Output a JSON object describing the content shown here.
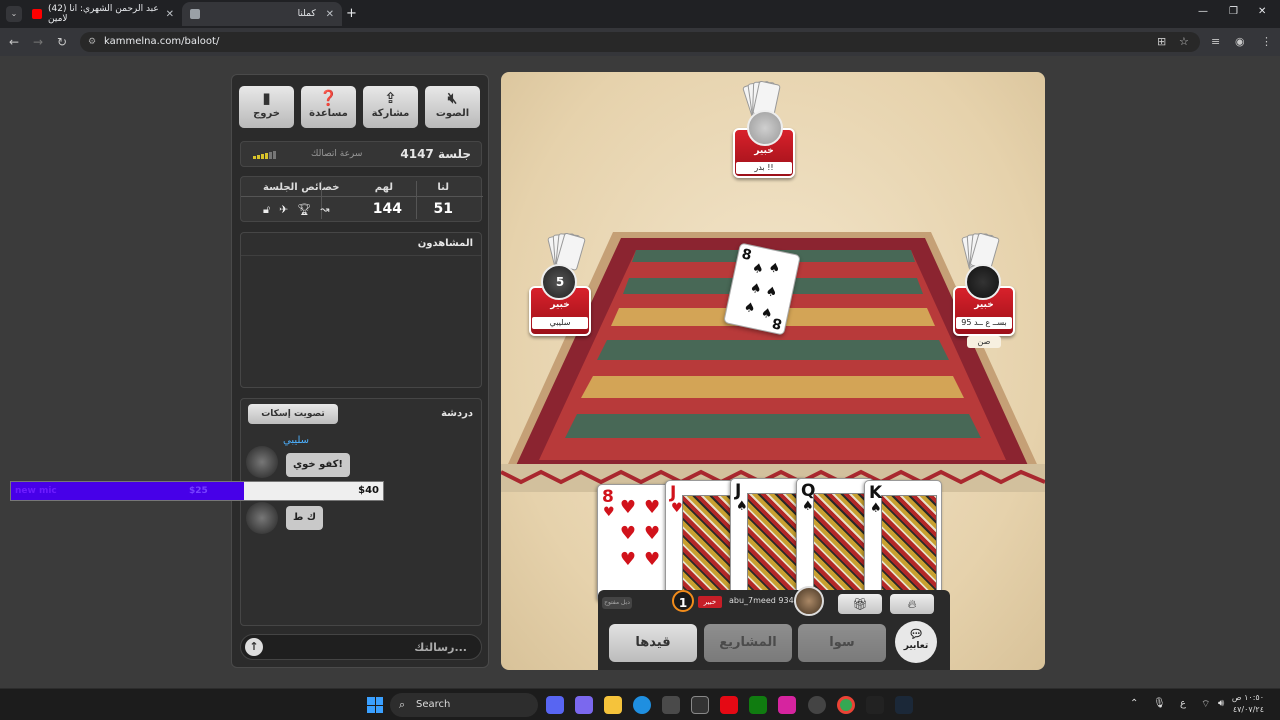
{
  "browser": {
    "tabs": [
      {
        "title": "(42) عبد الرحمن الشهري: انا لامين",
        "active": false,
        "favicon_color": "#ff0000"
      },
      {
        "title": "كملنا",
        "active": true,
        "favicon_color": "#9aa0a6"
      }
    ],
    "new_tab": "+",
    "url": "kammelna.com/baloot/"
  },
  "sidebar": {
    "buttons": [
      {
        "label": "خروج",
        "icon": "door-icon"
      },
      {
        "label": "مساعدة",
        "icon": "help-icon"
      },
      {
        "label": "مشاركة",
        "icon": "share-icon"
      },
      {
        "label": "الصوت",
        "icon": "mute-icon"
      }
    ],
    "session_label": "جلسة 4147",
    "connection_label": "سرعة اتصالك",
    "scores": {
      "us_label": "لنا",
      "them_label": "لهم",
      "props_label": "خصائص الجلسة",
      "us": "51",
      "them": "144"
    },
    "viewers_title": "المشاهدون",
    "chat": {
      "title": "دردشة",
      "vote_button": "تصويت إسكات",
      "messages": [
        {
          "sender": "سليبي",
          "text": "كفو خوي!"
        },
        {
          "sender": "",
          "text": "ك ط"
        }
      ],
      "input_placeholder": "رسالتك..."
    }
  },
  "overlay": {
    "label": "new mic",
    "current": "$25",
    "goal": "$40",
    "progress": 0.625,
    "fill_color": "#4700e8"
  },
  "game": {
    "top_player": {
      "level": "خبير",
      "name": "بدر !!"
    },
    "left_player": {
      "level": "خبير",
      "name": "سليبي",
      "badge": "5"
    },
    "right_player": {
      "level": "خبير",
      "name": "بســ ع ــد 95",
      "tag": "صن"
    },
    "me": {
      "level": "خبير",
      "name": "abu_7meed 9345",
      "turn_badge": "1",
      "small_label": "دبل مفتوح"
    },
    "table_card": {
      "rank": "8",
      "suit": "♠"
    },
    "hand": [
      {
        "rank": "8",
        "suit": "♥",
        "color": "#d1121b"
      },
      {
        "rank": "J",
        "suit": "♥",
        "color": "#d1121b"
      },
      {
        "rank": "J",
        "suit": "♠",
        "color": "#111111"
      },
      {
        "rank": "Q",
        "suit": "♠",
        "color": "#111111"
      },
      {
        "rank": "K",
        "suit": "♠",
        "color": "#111111"
      }
    ],
    "actions": {
      "qaydha": "قيدها",
      "projects": "المشاريع",
      "sawa": "سوا",
      "expressions": "تعابير"
    }
  },
  "taskbar": {
    "search": "Search",
    "clock_time": "١٠:٥٠ ص",
    "clock_date": "٤٧/٠٧/٢٤",
    "lang": "ع"
  }
}
